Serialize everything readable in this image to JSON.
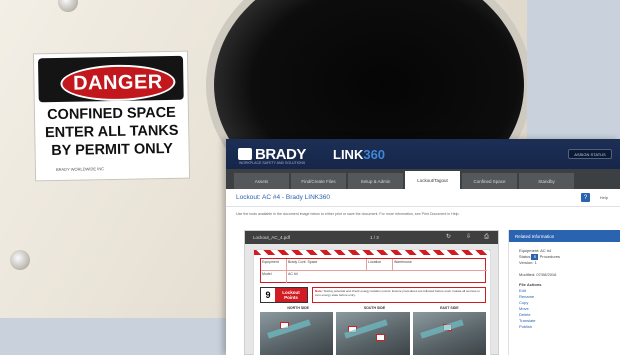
{
  "photo": {
    "sign": {
      "header": "DANGER",
      "lines": [
        "CONFINED SPACE",
        "ENTER ALL TANKS",
        "BY PERMIT ONLY"
      ],
      "fine_print": "BRADY WORLDWIDE INC"
    }
  },
  "app": {
    "brand": "BRADY",
    "brand_tag": "WORKPLACE SAFETY AND SOLUTIONS",
    "product": {
      "prefix": "LINK",
      "suffix": "360"
    },
    "header_button": "ASSIGN STATUS",
    "tabs": [
      "Assets",
      "Find/Create Files",
      "Setup & Admin",
      "Lockout/Tagout",
      "Confined Space",
      "Standby"
    ],
    "active_tab_index": 3,
    "page_title": "Lockout: AC #4 - Brady LINK360",
    "help_label": "Help",
    "instructions": "Use the tools available in the document image below to either print or save the document. For more information, see Print Document in Help.",
    "viewer": {
      "file_name": "Lockout_AC_4.pdf",
      "page": "1 / 3",
      "icons": [
        "rotate-icon",
        "download-icon",
        "print-icon"
      ]
    },
    "document": {
      "grid": {
        "equipment_label": "Equipment",
        "equipment_value": "Brady Conf. Space",
        "location_label": "Location",
        "location_value": "Warehouse",
        "model_label": "Model",
        "model_value": "AC #4"
      },
      "points_count": "9",
      "points_label": "Lockout Points",
      "note_label": "Note:",
      "note_text": "Testing potential and check energy isolation points. Ensure procedures are followed before work. Isolate all sources to zero energy state before entry.",
      "sides": [
        "NORTH SIDE",
        "SOUTH SIDE",
        "EAST SIDE"
      ]
    },
    "sidebar": {
      "title": "Related Information",
      "equipment": "Equipment: AC #4",
      "status_label": "Status",
      "status_value": "Procedures",
      "version": "Version: 1",
      "modified": "Modified: 07/08/2016",
      "file_actions_title": "File Actions",
      "actions": [
        "Edit",
        "Rename",
        "Copy",
        "Move",
        "Delete",
        "Translate",
        "Publish"
      ]
    }
  }
}
